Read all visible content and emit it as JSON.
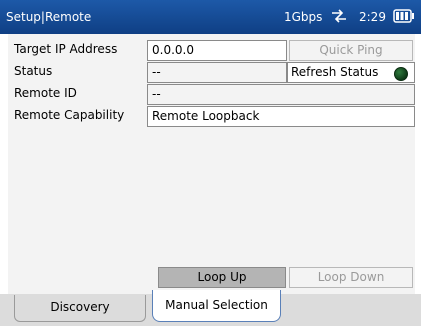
{
  "titlebar": {
    "title": "Setup|Remote",
    "link_speed": "1Gbps",
    "time": "2:29",
    "network_icon": "network-arrows-icon",
    "battery_icon": "battery-icon"
  },
  "form": {
    "target_ip": {
      "label": "Target IP Address",
      "value": "0.0.0.0"
    },
    "status": {
      "label": "Status",
      "value": "--"
    },
    "remote_id": {
      "label": "Remote ID",
      "value": "--"
    },
    "remote_capability": {
      "label": "Remote Capability",
      "value": "Remote Loopback"
    }
  },
  "buttons": {
    "quick_ping": "Quick Ping",
    "refresh_status": "Refresh Status",
    "loop_up": "Loop Up",
    "loop_down": "Loop Down"
  },
  "status_indicator_color": "#1f5c2c",
  "tabs": [
    {
      "label": "Discovery",
      "active": false
    },
    {
      "label": "Manual Selection",
      "active": true
    }
  ],
  "colors": {
    "titlebar": "#1d59a8",
    "content_bg": "#f3f3f3",
    "tab_active_border": "#5a80b8"
  }
}
